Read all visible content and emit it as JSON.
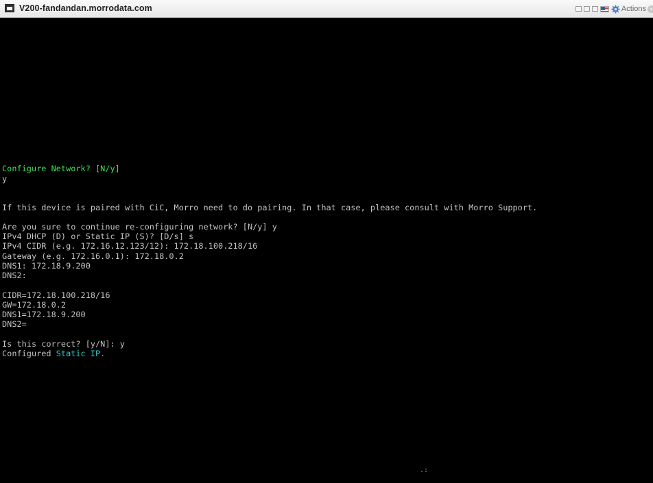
{
  "window": {
    "title": "V200-fandandan.morrodata.com",
    "actions_label": "Actions",
    "close_glyph": "×"
  },
  "console": {
    "configure_prompt": "Configure Network? [N/y]",
    "answer_y": "y",
    "pairing_note": "If this device is paired with CiC, Morro need to do pairing. In that case, please consult with Morro Support.",
    "confirm_continue": "Are you sure to continue re-configuring network? [N/y] y",
    "dhcp_static": "IPv4 DHCP (D) or Static IP (S)? [D/s] s",
    "cidr_prompt": "IPv4 CIDR (e.g. 172.16.12.123/12): 172.18.100.218/16",
    "gateway_prompt": "Gateway (e.g. 172.16.0.1): 172.18.0.2",
    "dns1_prompt": "DNS1: 172.18.9.200",
    "dns2_prompt": "DNS2:",
    "cidr_summary": "CIDR=172.18.100.218/16",
    "gw_summary": "GW=172.18.0.2",
    "dns1_summary": "DNS1=172.18.9.200",
    "dns2_summary": "DNS2=",
    "correct_prompt": "Is this correct? [y/N]: y",
    "configured_prefix": "Configured ",
    "configured_highlight": "Static IP.",
    "cursor_glyph": ".:"
  },
  "colors": {
    "prompt_green": "#3fe354",
    "highlight_cyan": "#2bcfcf",
    "text_gray": "#c4c4c4",
    "background": "#000000"
  }
}
